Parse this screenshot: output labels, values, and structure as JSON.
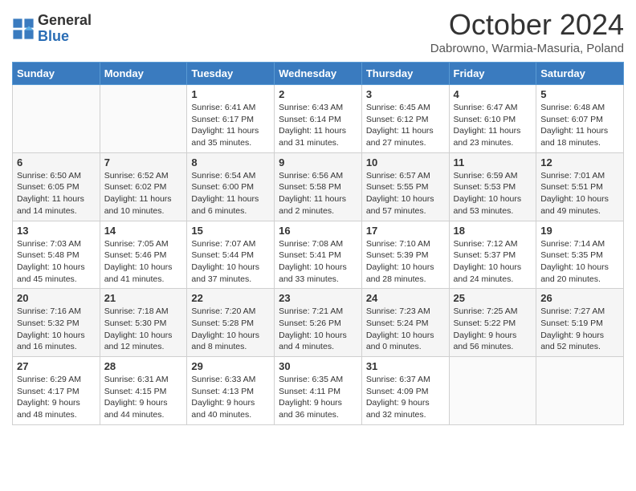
{
  "header": {
    "logo_general": "General",
    "logo_blue": "Blue",
    "month_title": "October 2024",
    "subtitle": "Dabrowno, Warmia-Masuria, Poland"
  },
  "days_of_week": [
    "Sunday",
    "Monday",
    "Tuesday",
    "Wednesday",
    "Thursday",
    "Friday",
    "Saturday"
  ],
  "weeks": [
    [
      {
        "day": "",
        "info": ""
      },
      {
        "day": "",
        "info": ""
      },
      {
        "day": "1",
        "info": "Sunrise: 6:41 AM\nSunset: 6:17 PM\nDaylight: 11 hours and 35 minutes."
      },
      {
        "day": "2",
        "info": "Sunrise: 6:43 AM\nSunset: 6:14 PM\nDaylight: 11 hours and 31 minutes."
      },
      {
        "day": "3",
        "info": "Sunrise: 6:45 AM\nSunset: 6:12 PM\nDaylight: 11 hours and 27 minutes."
      },
      {
        "day": "4",
        "info": "Sunrise: 6:47 AM\nSunset: 6:10 PM\nDaylight: 11 hours and 23 minutes."
      },
      {
        "day": "5",
        "info": "Sunrise: 6:48 AM\nSunset: 6:07 PM\nDaylight: 11 hours and 18 minutes."
      }
    ],
    [
      {
        "day": "6",
        "info": "Sunrise: 6:50 AM\nSunset: 6:05 PM\nDaylight: 11 hours and 14 minutes."
      },
      {
        "day": "7",
        "info": "Sunrise: 6:52 AM\nSunset: 6:02 PM\nDaylight: 11 hours and 10 minutes."
      },
      {
        "day": "8",
        "info": "Sunrise: 6:54 AM\nSunset: 6:00 PM\nDaylight: 11 hours and 6 minutes."
      },
      {
        "day": "9",
        "info": "Sunrise: 6:56 AM\nSunset: 5:58 PM\nDaylight: 11 hours and 2 minutes."
      },
      {
        "day": "10",
        "info": "Sunrise: 6:57 AM\nSunset: 5:55 PM\nDaylight: 10 hours and 57 minutes."
      },
      {
        "day": "11",
        "info": "Sunrise: 6:59 AM\nSunset: 5:53 PM\nDaylight: 10 hours and 53 minutes."
      },
      {
        "day": "12",
        "info": "Sunrise: 7:01 AM\nSunset: 5:51 PM\nDaylight: 10 hours and 49 minutes."
      }
    ],
    [
      {
        "day": "13",
        "info": "Sunrise: 7:03 AM\nSunset: 5:48 PM\nDaylight: 10 hours and 45 minutes."
      },
      {
        "day": "14",
        "info": "Sunrise: 7:05 AM\nSunset: 5:46 PM\nDaylight: 10 hours and 41 minutes."
      },
      {
        "day": "15",
        "info": "Sunrise: 7:07 AM\nSunset: 5:44 PM\nDaylight: 10 hours and 37 minutes."
      },
      {
        "day": "16",
        "info": "Sunrise: 7:08 AM\nSunset: 5:41 PM\nDaylight: 10 hours and 33 minutes."
      },
      {
        "day": "17",
        "info": "Sunrise: 7:10 AM\nSunset: 5:39 PM\nDaylight: 10 hours and 28 minutes."
      },
      {
        "day": "18",
        "info": "Sunrise: 7:12 AM\nSunset: 5:37 PM\nDaylight: 10 hours and 24 minutes."
      },
      {
        "day": "19",
        "info": "Sunrise: 7:14 AM\nSunset: 5:35 PM\nDaylight: 10 hours and 20 minutes."
      }
    ],
    [
      {
        "day": "20",
        "info": "Sunrise: 7:16 AM\nSunset: 5:32 PM\nDaylight: 10 hours and 16 minutes."
      },
      {
        "day": "21",
        "info": "Sunrise: 7:18 AM\nSunset: 5:30 PM\nDaylight: 10 hours and 12 minutes."
      },
      {
        "day": "22",
        "info": "Sunrise: 7:20 AM\nSunset: 5:28 PM\nDaylight: 10 hours and 8 minutes."
      },
      {
        "day": "23",
        "info": "Sunrise: 7:21 AM\nSunset: 5:26 PM\nDaylight: 10 hours and 4 minutes."
      },
      {
        "day": "24",
        "info": "Sunrise: 7:23 AM\nSunset: 5:24 PM\nDaylight: 10 hours and 0 minutes."
      },
      {
        "day": "25",
        "info": "Sunrise: 7:25 AM\nSunset: 5:22 PM\nDaylight: 9 hours and 56 minutes."
      },
      {
        "day": "26",
        "info": "Sunrise: 7:27 AM\nSunset: 5:19 PM\nDaylight: 9 hours and 52 minutes."
      }
    ],
    [
      {
        "day": "27",
        "info": "Sunrise: 6:29 AM\nSunset: 4:17 PM\nDaylight: 9 hours and 48 minutes."
      },
      {
        "day": "28",
        "info": "Sunrise: 6:31 AM\nSunset: 4:15 PM\nDaylight: 9 hours and 44 minutes."
      },
      {
        "day": "29",
        "info": "Sunrise: 6:33 AM\nSunset: 4:13 PM\nDaylight: 9 hours and 40 minutes."
      },
      {
        "day": "30",
        "info": "Sunrise: 6:35 AM\nSunset: 4:11 PM\nDaylight: 9 hours and 36 minutes."
      },
      {
        "day": "31",
        "info": "Sunrise: 6:37 AM\nSunset: 4:09 PM\nDaylight: 9 hours and 32 minutes."
      },
      {
        "day": "",
        "info": ""
      },
      {
        "day": "",
        "info": ""
      }
    ]
  ]
}
